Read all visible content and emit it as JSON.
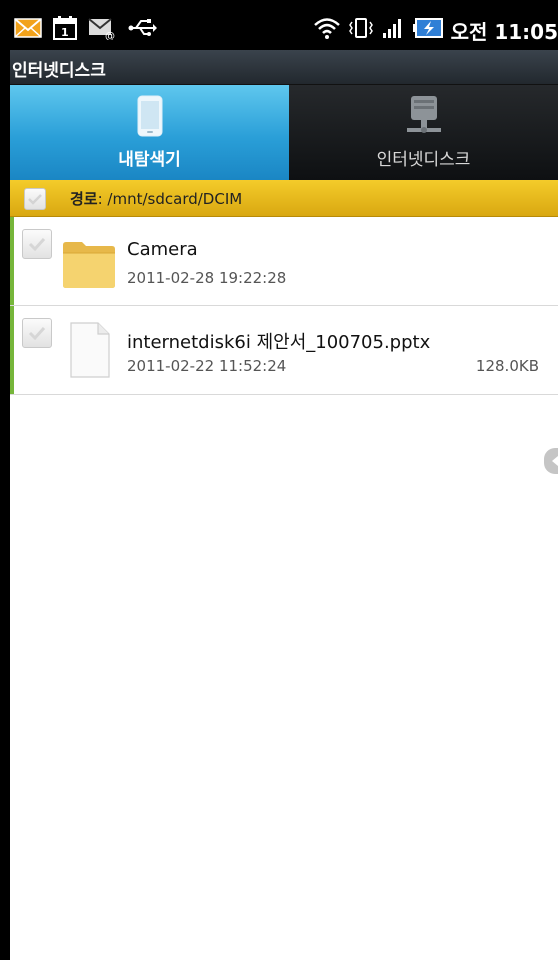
{
  "status_bar": {
    "time": "오전 11:05",
    "left_icons": [
      "mail-icon",
      "calendar-icon",
      "email-icon",
      "usb-icon"
    ],
    "right_icons": [
      "wifi-icon",
      "vibrate-icon",
      "signal-icon",
      "battery-charging-icon"
    ]
  },
  "app": {
    "title": "인터넷디스크"
  },
  "tabs": [
    {
      "label": "내탐색기",
      "icon": "phone-icon",
      "active": true
    },
    {
      "label": "인터넷디스크",
      "icon": "network-drive-icon",
      "active": false
    }
  ],
  "path": {
    "label": "경로",
    "value": ": /mnt/sdcard/DCIM"
  },
  "files": [
    {
      "name": "Camera",
      "date": "2011-02-28 19:22:28",
      "size": "",
      "type": "folder"
    },
    {
      "name": "internetdisk6i 제안서_100705.pptx",
      "date": "2011-02-22 11:52:24",
      "size": "128.0KB",
      "type": "file"
    }
  ],
  "colors": {
    "accent_tab": "#2a9fd8",
    "path_bar": "#e6b81c",
    "selection_bar": "#76b63a"
  }
}
